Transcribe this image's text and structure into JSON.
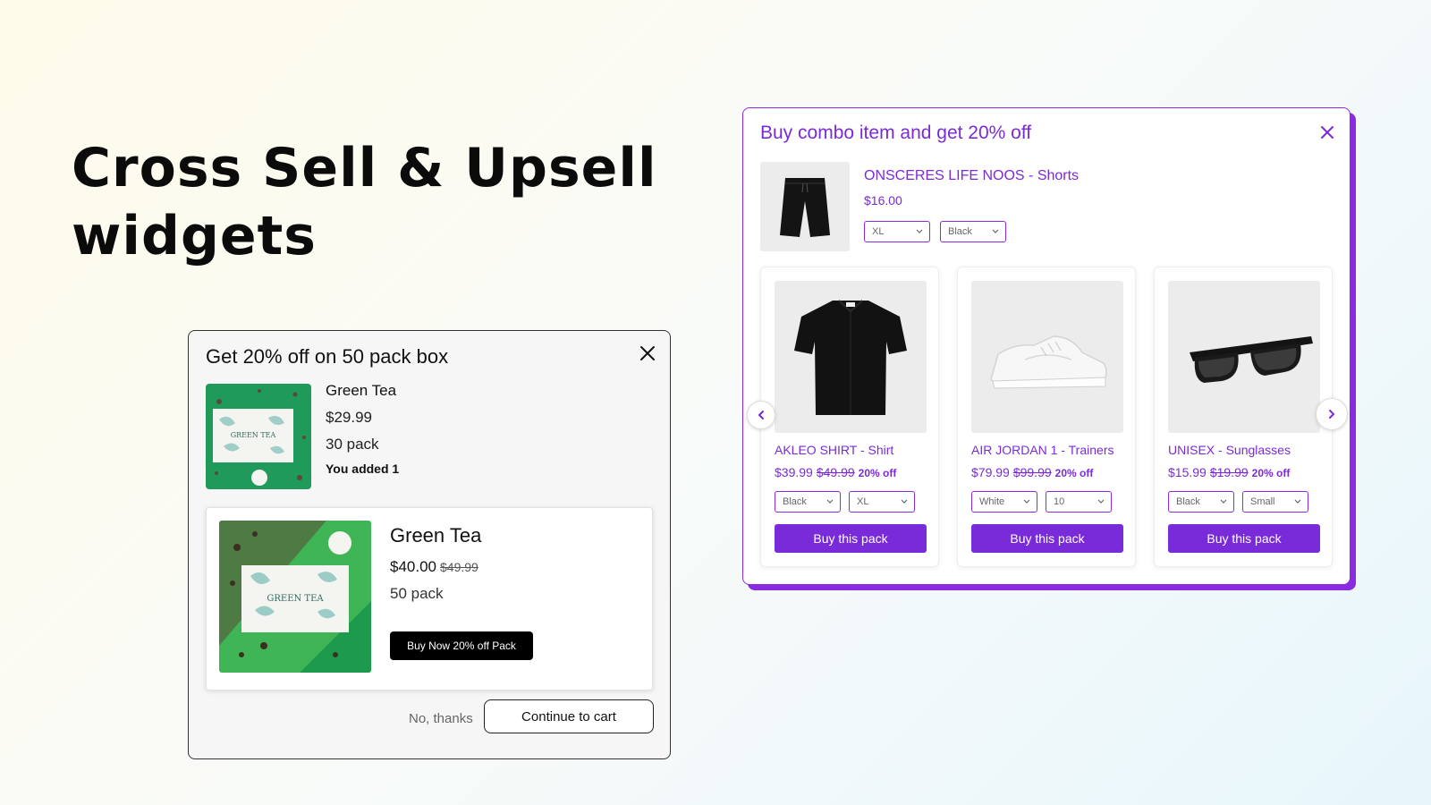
{
  "hero": {
    "title": "Cross Sell & Upsell\nwidgets"
  },
  "tea_popup": {
    "title": "Get 20% off on 50 pack box",
    "close_icon": "close-icon",
    "current_item": {
      "name": "Green Tea",
      "price": "$29.99",
      "pack": "30 pack",
      "added_note": "You added 1",
      "image_text": "GREEN TEA"
    },
    "offer": {
      "name": "Green Tea",
      "price": "$40.00",
      "old_price": "$49.99",
      "pack": "50 pack",
      "button_label": "Buy Now 20% off Pack",
      "image_text": "GREEN TEA"
    },
    "decline_label": "No, thanks",
    "continue_label": "Continue to cart"
  },
  "combo": {
    "title": "Buy combo item and get 20% off",
    "close_icon": "close-icon",
    "main_product": {
      "name": "ONSCERES LIFE NOOS - Shorts",
      "price": "$16.00",
      "size": "XL",
      "color": "Black"
    },
    "cards": [
      {
        "name": "AKLEO SHIRT - Shirt",
        "price": "$39.99",
        "old_price": "$49.99",
        "discount": "20% off",
        "option1": "Black",
        "option2": "XL",
        "button_label": "Buy this pack",
        "icon": "shirt-icon"
      },
      {
        "name": "AIR JORDAN 1 - Trainers",
        "price": "$79.99",
        "old_price": "$99.99",
        "discount": "20% off",
        "option1": "White",
        "option2": "10",
        "button_label": "Buy this pack",
        "icon": "sneaker-icon"
      },
      {
        "name": "UNISEX - Sunglasses",
        "price": "$15.99",
        "old_price": "$19.99",
        "discount": "20% off",
        "option1": "Black",
        "option2": "Small",
        "button_label": "Buy this pack",
        "icon": "sunglasses-icon"
      }
    ],
    "prev_icon": "chevron-left-icon",
    "next_icon": "chevron-right-icon"
  },
  "colors": {
    "accent_purple": "#7a2bd9",
    "tea_green": "#1f9a5a",
    "black_button": "#000000"
  }
}
